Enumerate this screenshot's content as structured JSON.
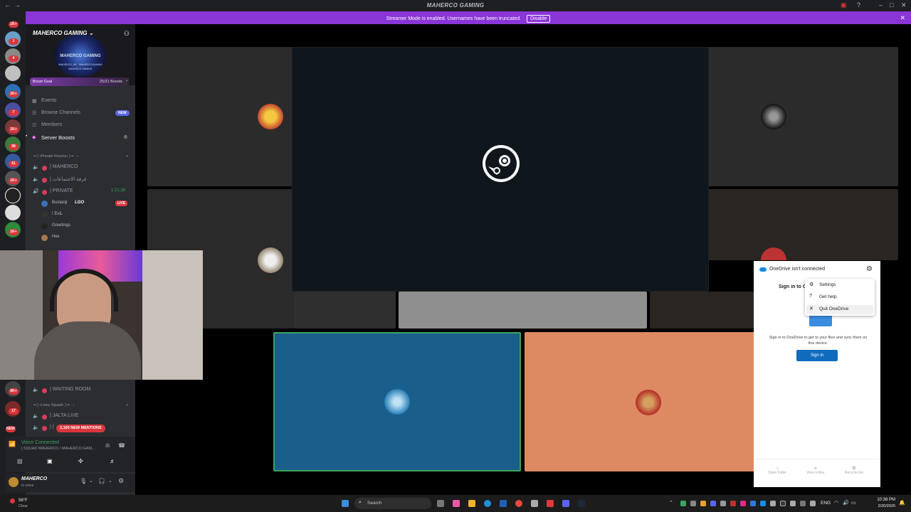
{
  "window": {
    "title": "MAHERCO GAMING"
  },
  "banner": {
    "message": "Streamer Mode is enabled. Usernames have been truncated.",
    "button": "Disable"
  },
  "rail": {
    "badges": [
      "1K+",
      "1",
      "4",
      "2K+",
      "7",
      "1K+",
      "99",
      "61",
      "1K+",
      "1K+",
      "8K+",
      "17",
      "NEW"
    ]
  },
  "server": {
    "name": "MAHERCO GAMING",
    "banner_text": "MAHERCO GAMING",
    "banner_subtext": "/MAHERCO_HE · /MAHERCOGAMING",
    "banner_subtext2": "MAHERCO GAMING",
    "boost_label": "Boost Goal",
    "boost_count": "25/31 Boosts"
  },
  "nav": [
    {
      "label": "Events"
    },
    {
      "label": "Browse Channels",
      "badge": "NEW"
    },
    {
      "label": "Members"
    },
    {
      "label": "Server Boosts",
      "badge": "8"
    }
  ],
  "channels": {
    "category_private": "· ━ ( ‹Private Rooms› ) ━ · ‹",
    "maherco": "| MAHERCO",
    "arabic": "| غرفة الاجتماعات",
    "private": "| PRIVATE",
    "private_time": "1:21:26",
    "users": [
      {
        "name": "Bustanji",
        "extra": "LGO",
        "live": "LIVE"
      },
      {
        "name": "! EviL"
      },
      {
        "name": "Greetings"
      },
      {
        "name": "Hex"
      }
    ],
    "waiting_room": "| WAITING ROOM",
    "category_lives": "· ━ ( ‹Lives Squad› ) ━ · ‹",
    "jalta_live": "| JALTA LIVE",
    "mentions": "2,160 NEW MENTIONS"
  },
  "voice": {
    "status": "Voice Connected",
    "channel": "| SQUAD MAHERCO / MAHERCO GAM..."
  },
  "user": {
    "name": "MAHERCO",
    "status": "In voice"
  },
  "onedrive": {
    "title": "OneDrive isn't connected",
    "sign_in_heading": "Sign in to OneDrive",
    "description": "Sign in to OneDrive to get to your files and sync them on this device.",
    "sign_in_button": "Sign in",
    "menu": [
      "Settings",
      "Get help",
      "Quit OneDrive"
    ],
    "footer": [
      "Open folder",
      "View online",
      "Recycle bin"
    ]
  },
  "taskbar": {
    "weather_temp": "58°F",
    "weather_desc": "Clear",
    "search_placeholder": "Search",
    "lang": "ENG",
    "time": "10:38 PM",
    "date": "2/20/2026"
  },
  "colors": {
    "banner": "#8a35d6",
    "tile_blue": "#1a5e8c",
    "tile_orange": "#dd8a62",
    "steam_panel": "#0f171d",
    "sign_in_blue": "#0f6cbd"
  }
}
